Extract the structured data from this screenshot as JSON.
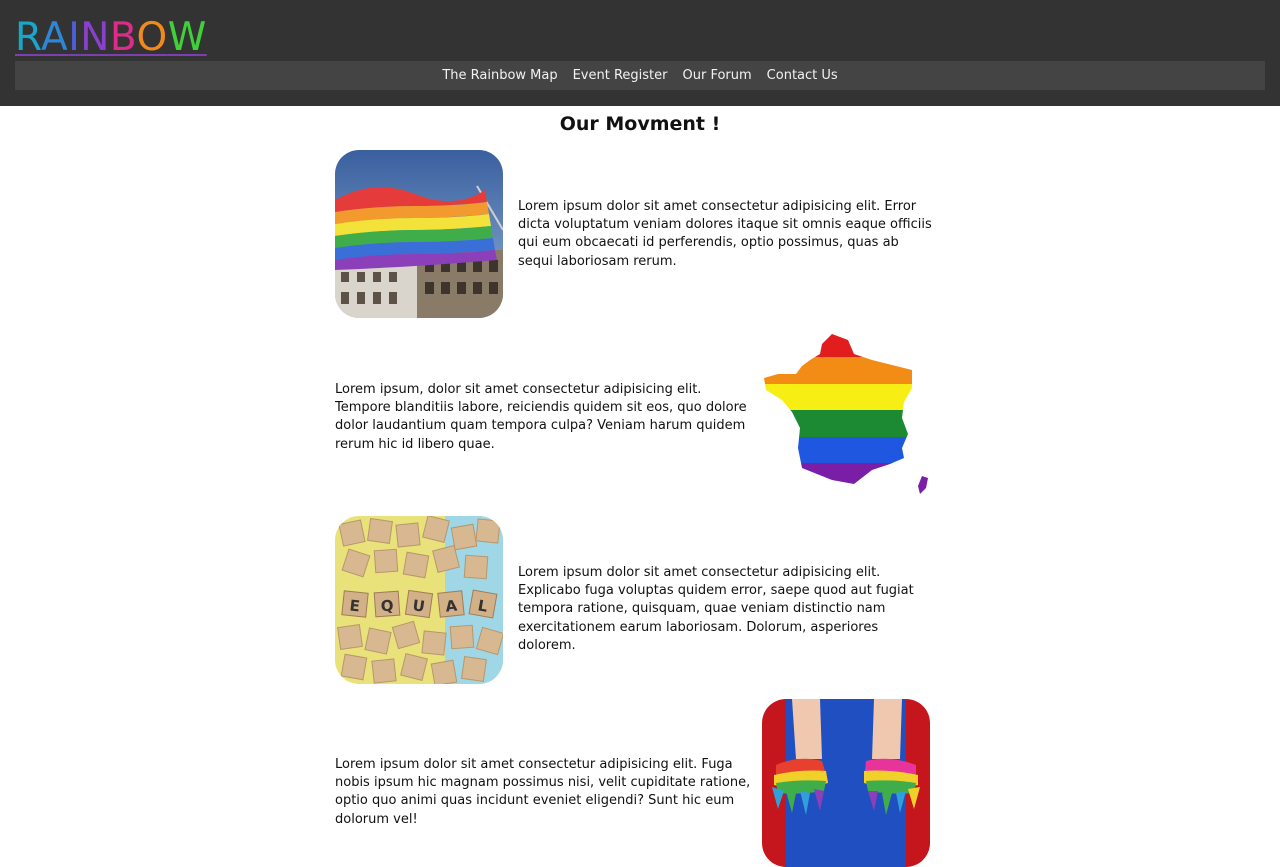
{
  "header": {
    "logo_letters": [
      {
        "char": "R",
        "color": "#1aa6c9"
      },
      {
        "char": "A",
        "color": "#2f86d6"
      },
      {
        "char": "I",
        "color": "#4f5fd8"
      },
      {
        "char": "N",
        "color": "#8a3fd0"
      },
      {
        "char": "B",
        "color": "#e02a8a"
      },
      {
        "char": "O",
        "color": "#f08a1c"
      },
      {
        "char": "W",
        "color": "#3fd03a"
      }
    ],
    "nav": [
      {
        "label": "The Rainbow Map"
      },
      {
        "label": "Event Register"
      },
      {
        "label": "Our Forum"
      },
      {
        "label": "Contact Us"
      }
    ],
    "background_color": "#333333",
    "navbar_color": "#444444"
  },
  "main": {
    "title": "Our Movment !",
    "sections": [
      {
        "text": "Lorem ipsum dolor sit amet consectetur adipisicing elit. Error dicta voluptatum veniam dolores itaque sit omnis eaque officiis qui eum obcaecati id perferendis, optio possimus, quas ab sequi laboriosam rerum.",
        "image": "rainbow-flag-photo"
      },
      {
        "text": "Lorem ipsum, dolor sit amet consectetur adipisicing elit. Tempore blanditiis labore, reiciendis quidem sit eos, quo dolore dolor laudantium quam tempora culpa? Veniam harum quidem rerum hic id libero quae.",
        "image": "rainbow-france-map"
      },
      {
        "text": "Lorem ipsum dolor sit amet consectetur adipisicing elit. Explicabo fuga voluptas quidem error, saepe quod aut fugiat tempora ratione, quisquam, quae veniam distinctio nam exercitationem earum laboriosam. Dolorum, asperiores dolorem.",
        "image": "equal-scrabble-tiles-photo"
      },
      {
        "text": "Lorem ipsum dolor sit amet consectetur adipisicing elit. Fuga nobis ipsum hic magnam possimus nisi, velit cupiditate ratione, optio quo animi quas incidunt eveniet eligendi? Sunt hic eum dolorum vel!",
        "image": "rainbow-painted-hands-photo"
      }
    ],
    "tile_letters": [
      "E",
      "Q",
      "U",
      "A",
      "L"
    ]
  }
}
